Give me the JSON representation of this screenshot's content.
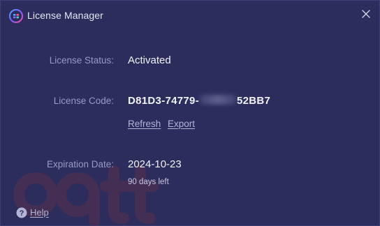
{
  "window": {
    "title": "License Manager",
    "icon": "license-manager-app-icon",
    "close_icon": "close-icon"
  },
  "license": {
    "status_label": "License Status:",
    "status_value": "Activated",
    "code_label": "License Code:",
    "code_prefix": "D81D3-74779-",
    "code_suffix": "52BB7",
    "refresh_label": "Refresh",
    "export_label": "Export",
    "expiration_label": "Expiration Date:",
    "expiration_value": "2024-10-23",
    "days_left": "90 days left"
  },
  "footer": {
    "help_label": "Help",
    "help_icon": "question-mark-icon"
  },
  "colors": {
    "background": "#2c2c5d",
    "label": "#9a9ac4",
    "value": "#f2f2fa",
    "link": "#b4b4d6",
    "watermark": "#c0392b"
  }
}
